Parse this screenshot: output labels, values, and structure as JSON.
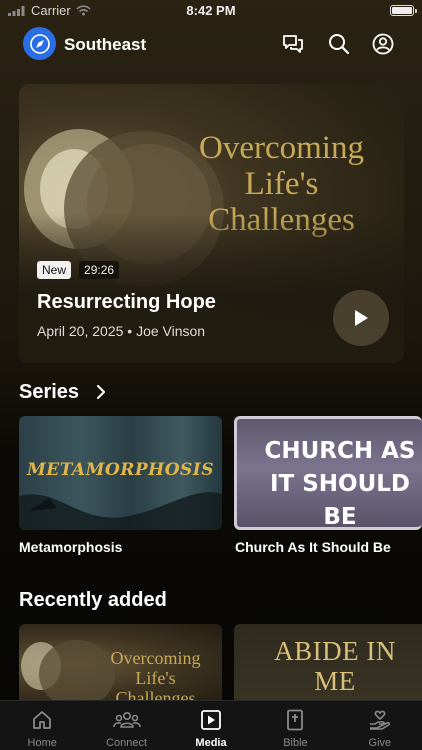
{
  "status_bar": {
    "carrier": "Carrier",
    "time": "8:42 PM"
  },
  "header": {
    "church_name": "Southeast",
    "icons": [
      "chat-icon",
      "search-icon",
      "account-icon"
    ]
  },
  "featured": {
    "artwork_text": [
      "Overcoming",
      "Life's",
      "Challenges"
    ],
    "badge_new": "New",
    "duration": "29:26",
    "title": "Resurrecting Hope",
    "meta": "April 20, 2025 • Joe Vinson"
  },
  "series": {
    "title": "Series",
    "items": [
      {
        "label": "Metamorphosis",
        "art_text": "METAMORPHOSIS"
      },
      {
        "label": "Church As It Should Be",
        "art_text": "CHURCH AS IT SHOULD BE"
      }
    ]
  },
  "recent": {
    "title": "Recently added",
    "items": [
      {
        "art_text": [
          "Overcoming",
          "Life's",
          "Challenges"
        ]
      },
      {
        "art_text": [
          "ABIDE IN",
          "ME"
        ]
      }
    ]
  },
  "tabs": [
    {
      "label": "Home",
      "icon": "home-icon"
    },
    {
      "label": "Connect",
      "icon": "people-icon"
    },
    {
      "label": "Media",
      "icon": "media-icon",
      "active": true
    },
    {
      "label": "Bible",
      "icon": "bible-icon"
    },
    {
      "label": "Give",
      "icon": "give-icon"
    }
  ],
  "colors": {
    "accent": "#2a6ee6",
    "artwork_gold": "#c7a95a"
  }
}
